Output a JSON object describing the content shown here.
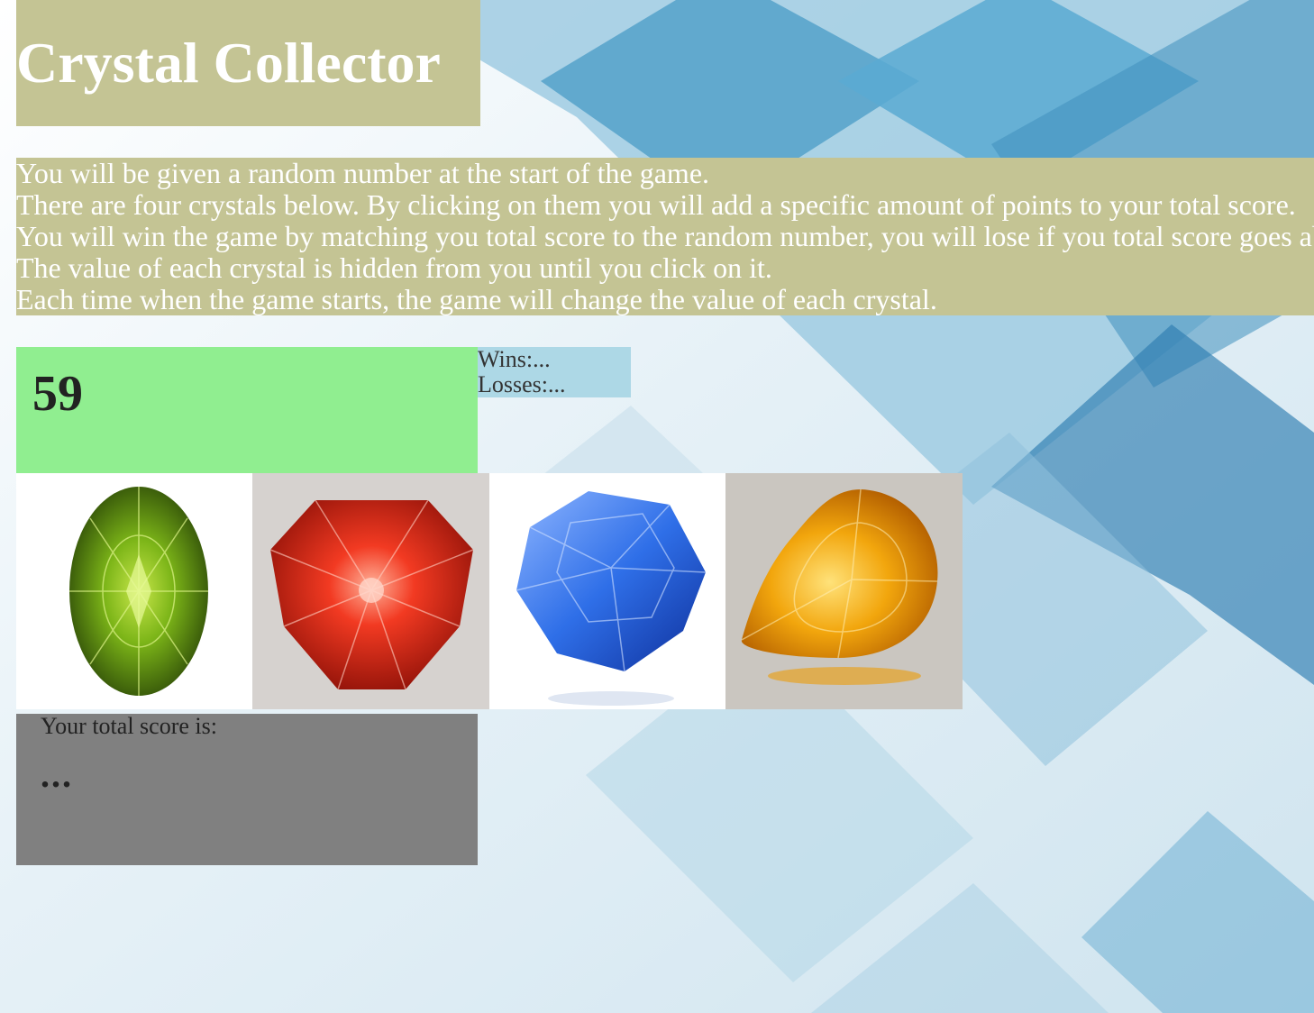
{
  "header": {
    "title": "Crystal Collector"
  },
  "instructions": [
    "You will be given a random number at the start of the game.",
    "There are four crystals below. By clicking on them you will add a specific amount of points to your total score.",
    "You will win the game by matching you total score to the random number, you will lose if you total score goes above the random number.",
    "The value of each crystal is hidden from you until you click on it.",
    "Each time when the game starts, the game will change the value of each crystal."
  ],
  "target": {
    "number": "59"
  },
  "stats": {
    "wins": "Wins:...",
    "losses": "Losses:..."
  },
  "crystals": [
    {
      "icon": "green-crystal-icon",
      "color": "#7cb518"
    },
    {
      "icon": "red-crystal-icon",
      "color": "#e8281b"
    },
    {
      "icon": "blue-crystal-icon",
      "color": "#2f6fe8"
    },
    {
      "icon": "yellow-crystal-icon",
      "color": "#f2a60d"
    }
  ],
  "score": {
    "label": "Your total score is:",
    "value": "..."
  },
  "colors": {
    "header_bg": "#c4c494",
    "target_bg": "#90ee90",
    "stats_bg": "#add8e6",
    "score_bg": "#808080"
  }
}
